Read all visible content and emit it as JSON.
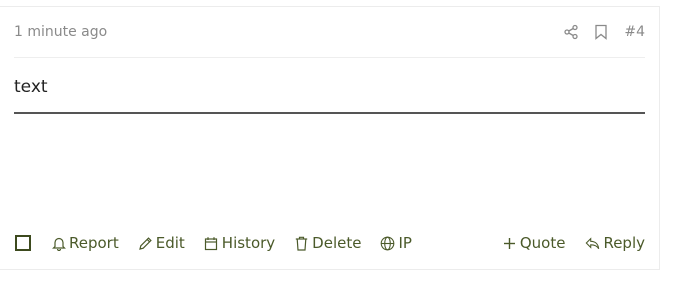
{
  "post": {
    "timestamp": "1 minute ago",
    "number": "#4",
    "body_text": "text",
    "header_icons": [
      "share-icon",
      "bookmark-icon"
    ]
  },
  "actions": {
    "left": [
      {
        "id": "report",
        "label": "Report",
        "icon": "bell-icon"
      },
      {
        "id": "edit",
        "label": "Edit",
        "icon": "pencil-icon"
      },
      {
        "id": "history",
        "label": "History",
        "icon": "calendar-icon"
      },
      {
        "id": "delete",
        "label": "Delete",
        "icon": "trash-icon"
      },
      {
        "id": "ip",
        "label": "IP",
        "icon": "globe-icon"
      }
    ],
    "right": [
      {
        "id": "quote",
        "label": "Quote",
        "icon": "plus-icon"
      },
      {
        "id": "reply",
        "label": "Reply",
        "icon": "reply-icon"
      }
    ]
  },
  "colors": {
    "action_text": "#4b5a2a",
    "muted_text": "#8a8a8a"
  }
}
